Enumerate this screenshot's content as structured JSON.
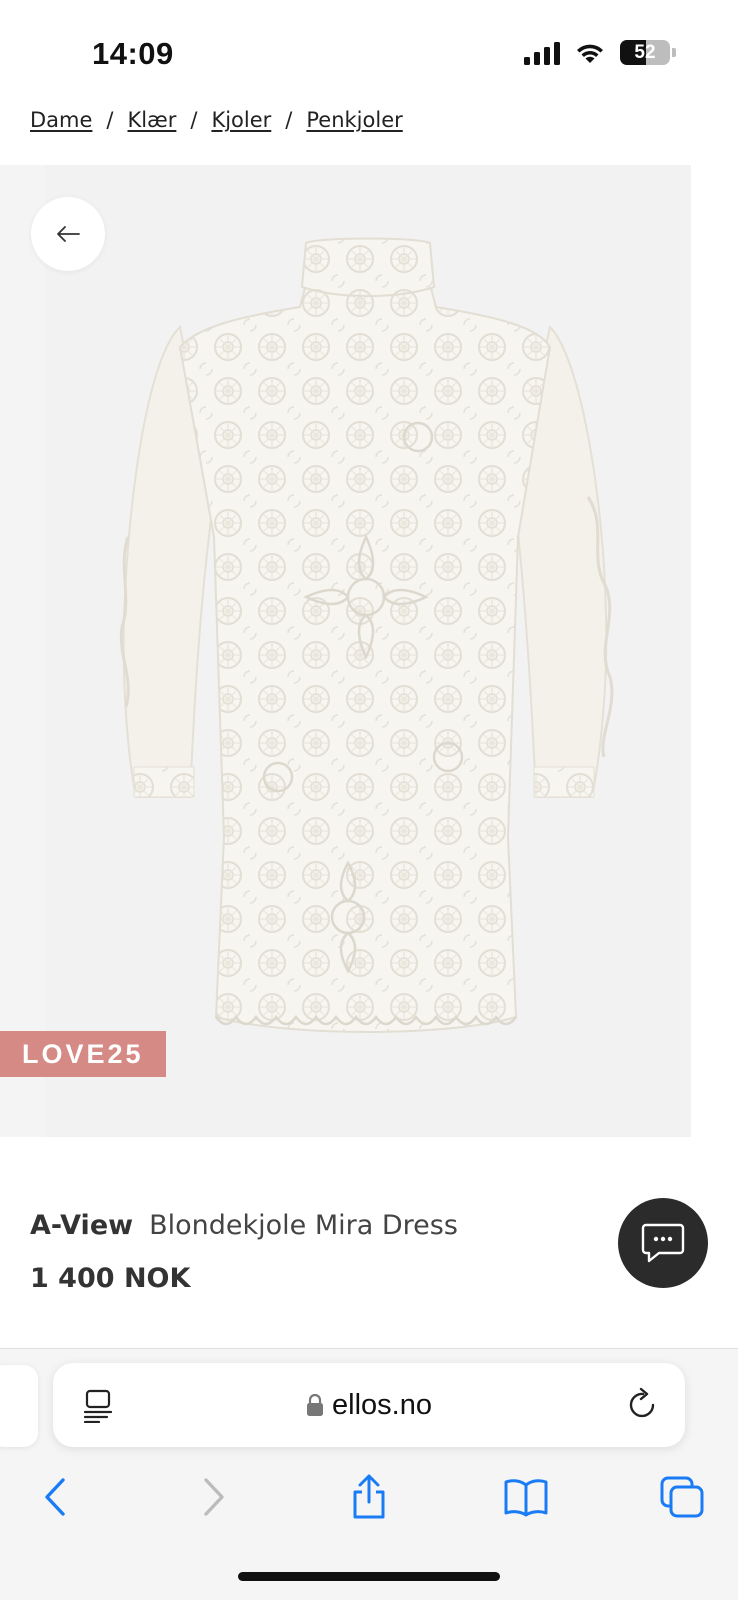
{
  "status_bar": {
    "time": "14:09",
    "battery": "52",
    "battery_level": 0.52,
    "icons": [
      "cellular-signal-icon",
      "wifi-icon",
      "battery-icon"
    ]
  },
  "breadcrumb": {
    "items": [
      "Dame",
      "Klær",
      "Kjoler",
      "Penkjoler"
    ],
    "separator": "/"
  },
  "product": {
    "image_alt": "white lace dress",
    "badge": "LOVE25",
    "brand": "A-View",
    "name": "Blondekjole Mira Dress",
    "price": "1 400 NOK"
  },
  "browser": {
    "url": "ellos.no",
    "icons": [
      "reader-icon",
      "lock-icon",
      "reload-icon",
      "back-icon",
      "forward-icon",
      "share-icon",
      "bookmarks-icon",
      "tabs-icon"
    ]
  },
  "colors": {
    "badge": "#d68a85",
    "accent": "#1a7cf5",
    "chat_button": "#2b2b2b"
  }
}
